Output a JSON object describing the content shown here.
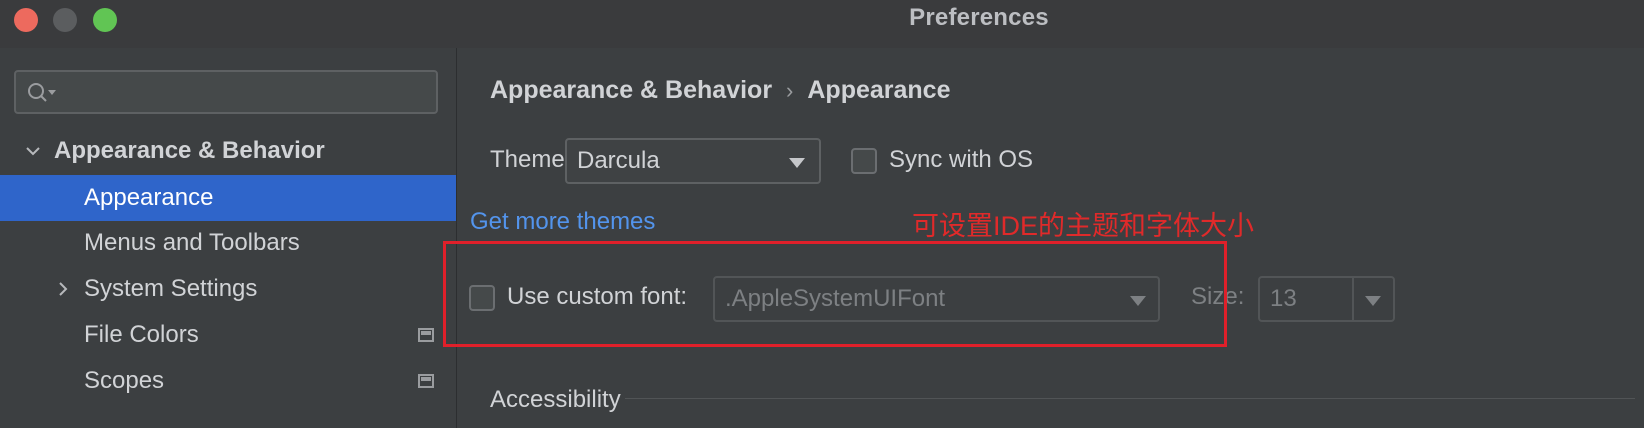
{
  "window": {
    "title": "Preferences"
  },
  "sidebar": {
    "search": {
      "value": "",
      "placeholder": ""
    },
    "items": [
      {
        "label": "Appearance & Behavior",
        "expanded": true,
        "level": 0
      },
      {
        "label": "Appearance",
        "selected": true,
        "level": 1
      },
      {
        "label": "Menus and Toolbars",
        "level": 1
      },
      {
        "label": "System Settings",
        "collapsed": true,
        "level": 1
      },
      {
        "label": "File Colors",
        "level": 1,
        "icon": "project-level-icon"
      },
      {
        "label": "Scopes",
        "level": 1,
        "icon": "project-level-icon"
      }
    ]
  },
  "main": {
    "breadcrumb": {
      "parent": "Appearance & Behavior",
      "separator": "›",
      "current": "Appearance"
    },
    "theme": {
      "label": "Theme:",
      "value": "Darcula",
      "sync_label": "Sync with OS",
      "sync_checked": false
    },
    "get_more_themes": "Get more themes",
    "annotation": "可设置IDE的主题和字体大小",
    "custom_font": {
      "label": "Use custom font:",
      "checked": false,
      "font_value": ".AppleSystemUIFont",
      "size_label": "Size:",
      "size_value": "13"
    },
    "accessibility_label": "Accessibility"
  },
  "colors": {
    "background": "#3c3f41",
    "selection": "#2f65ca",
    "link": "#5394ec",
    "annotation": "#e02a2a",
    "close": "#ed6a5e",
    "maximize": "#61c554"
  }
}
